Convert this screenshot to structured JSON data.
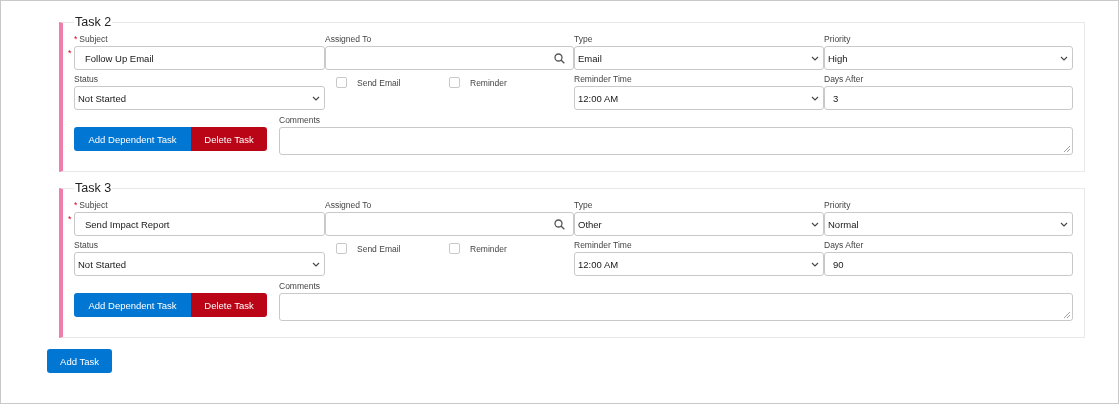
{
  "tasks": [
    {
      "title": "Task 2",
      "subject": {
        "label": "Subject",
        "label_mark": "*",
        "field_mark": "*",
        "value": "Follow Up Email"
      },
      "assigned_to": {
        "label": "Assigned To"
      },
      "type": {
        "label": "Type",
        "value": "Email"
      },
      "priority": {
        "label": "Priority",
        "value": "High"
      },
      "status": {
        "label": "Status",
        "value": "Not Started"
      },
      "checkboxes": [
        {
          "label": "Send Email",
          "checked": false
        },
        {
          "label": "Reminder",
          "checked": false
        }
      ],
      "reminder_time": {
        "label": "Reminder Time",
        "value": "12:00 AM"
      },
      "days_after": {
        "label": "Days After",
        "value": "3"
      },
      "comments": {
        "label": "Comments"
      },
      "buttons": [
        "Add Dependent Task",
        "Delete Task"
      ]
    },
    {
      "title": "Task 3",
      "subject": {
        "label": "Subject",
        "label_mark": "*",
        "field_mark": "*",
        "value": "Send Impact Report"
      },
      "assigned_to": {
        "label": "Assigned To"
      },
      "type": {
        "label": "Type",
        "value": "Other"
      },
      "priority": {
        "label": "Priority",
        "value": "Normal"
      },
      "status": {
        "label": "Status",
        "value": "Not Started"
      },
      "checkboxes": [
        {
          "label": "Send Email",
          "checked": false
        },
        {
          "label": "Reminder",
          "checked": false
        }
      ],
      "reminder_time": {
        "label": "Reminder Time",
        "value": "12:00 AM"
      },
      "days_after": {
        "label": "Days After",
        "value": "90"
      },
      "comments": {
        "label": "Comments"
      },
      "buttons": [
        "Add Dependent Task",
        "Delete Task"
      ]
    }
  ],
  "add_button": "Add Task"
}
